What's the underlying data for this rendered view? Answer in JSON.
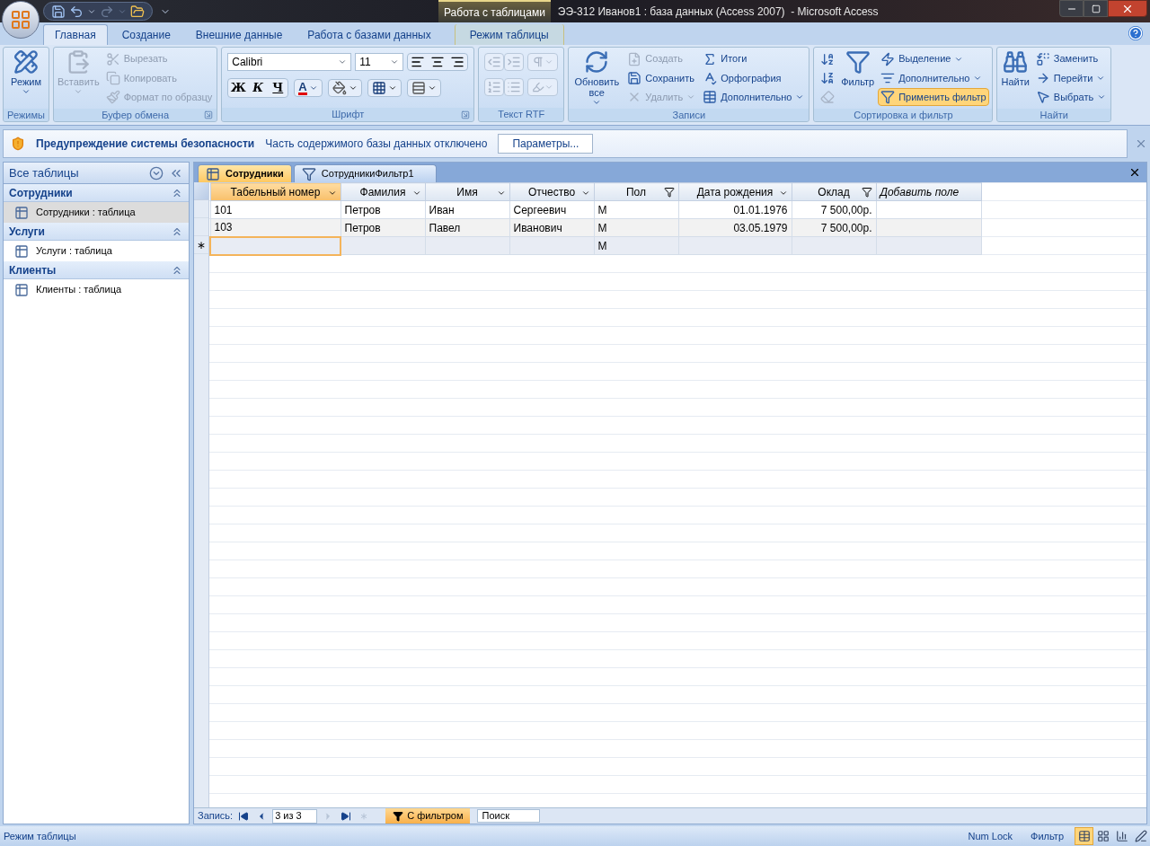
{
  "title_bar": {
    "context_tab": "Работа с таблицами",
    "title": "ЭЭ-312 Иванов1 : база данных (Access 2007)  - Microsoft Access"
  },
  "ribbon_tabs": [
    {
      "label": "Главная",
      "selected": true,
      "kind": "normal"
    },
    {
      "label": "Создание",
      "selected": false,
      "kind": "normal"
    },
    {
      "label": "Внешние данные",
      "selected": false,
      "kind": "normal"
    },
    {
      "label": "Работа с базами данных",
      "selected": false,
      "kind": "normal"
    },
    {
      "label": "Режим таблицы",
      "selected": false,
      "kind": "context"
    }
  ],
  "ribbon_groups": [
    {
      "label": "Режимы",
      "kind": "buttons",
      "sections": [
        {
          "kind": "large",
          "items": [
            {
              "label": "Режим",
              "disabled": false,
              "dropdown": true
            }
          ]
        }
      ]
    },
    {
      "label": "Буфер обмена",
      "kind": "buttons",
      "launcher": true,
      "sections": [
        {
          "kind": "large",
          "items": [
            {
              "label": "Вставить",
              "disabled": true,
              "dropdown": true
            }
          ]
        },
        {
          "kind": "column",
          "items": [
            {
              "label": "Вырезать",
              "disabled": true
            },
            {
              "label": "Копировать",
              "disabled": true
            },
            {
              "label": "Формат по образцу",
              "disabled": true
            }
          ]
        }
      ]
    },
    {
      "label": "Шрифт",
      "kind": "font",
      "launcher": true,
      "font": "Calibri",
      "size": "11",
      "format_buttons": [
        "Ж",
        "К",
        "Ч"
      ],
      "font_color_glyph": "A"
    },
    {
      "label": "Текст RTF",
      "kind": "rtf"
    },
    {
      "label": "Записи",
      "kind": "buttons",
      "sections": [
        {
          "kind": "large",
          "items": [
            {
              "label": "Обновить все",
              "disabled": false,
              "dropdown": true
            }
          ]
        },
        {
          "kind": "column",
          "items": [
            {
              "label": "Создать",
              "disabled": true
            },
            {
              "label": "Сохранить",
              "disabled": false
            },
            {
              "label": "Удалить",
              "disabled": true,
              "dropdown": true
            }
          ]
        },
        {
          "kind": "column",
          "items": [
            {
              "label": "Итоги",
              "disabled": false
            },
            {
              "label": "Орфография",
              "disabled": false
            },
            {
              "label": "Дополнительно",
              "disabled": false,
              "dropdown": true
            }
          ]
        }
      ]
    },
    {
      "label": "Сортировка и фильтр",
      "kind": "buttons",
      "sections": [
        {
          "kind": "column",
          "items": [
            {
              "disabled": false
            },
            {
              "disabled": false
            },
            {
              "disabled": true
            }
          ]
        },
        {
          "kind": "large",
          "items": [
            {
              "label": "Фильтр",
              "disabled": false
            }
          ]
        },
        {
          "kind": "column",
          "items": [
            {
              "label": "Выделение",
              "disabled": false,
              "dropdown": true
            },
            {
              "label": "Дополнительно",
              "disabled": false,
              "dropdown": true
            },
            {
              "label": "Применить фильтр",
              "disabled": false,
              "active": true
            }
          ]
        }
      ]
    },
    {
      "label": "Найти",
      "kind": "buttons",
      "sections": [
        {
          "kind": "large",
          "items": [
            {
              "label": "Найти",
              "disabled": false
            }
          ]
        },
        {
          "kind": "column",
          "items": [
            {
              "label": "Заменить",
              "disabled": false
            },
            {
              "label": "Перейти",
              "disabled": false,
              "dropdown": true
            },
            {
              "label": "Выбрать",
              "disabled": false,
              "dropdown": true
            }
          ]
        }
      ]
    }
  ],
  "security_bar": {
    "title": "Предупреждение системы безопасности",
    "message": "Часть содержимого базы данных отключено",
    "button": "Параметры..."
  },
  "nav_pane": {
    "header": "Все таблицы",
    "groups": [
      {
        "label": "Сотрудники",
        "items": [
          {
            "label": "Сотрудники : таблица",
            "selected": true
          }
        ]
      },
      {
        "label": "Услуги",
        "items": [
          {
            "label": "Услуги : таблица",
            "selected": false
          }
        ]
      },
      {
        "label": "Клиенты",
        "items": [
          {
            "label": "Клиенты : таблица",
            "selected": false
          }
        ]
      }
    ]
  },
  "doc_tabs": [
    {
      "label": "Сотрудники",
      "selected": true,
      "kind": "table"
    },
    {
      "label": "СотрудникиФильтр1",
      "selected": false,
      "kind": "filter"
    }
  ],
  "table": {
    "columns": [
      {
        "label": "Табельный номер",
        "kind": "field",
        "filtered": false,
        "numeric": false,
        "selected": true
      },
      {
        "label": "Фамилия",
        "kind": "field",
        "filtered": false,
        "numeric": false,
        "selected": false
      },
      {
        "label": "Имя",
        "kind": "field",
        "filtered": false,
        "numeric": false,
        "selected": false
      },
      {
        "label": "Отчество",
        "kind": "field",
        "filtered": false,
        "numeric": false,
        "selected": false
      },
      {
        "label": "Пол",
        "kind": "field",
        "filtered": true,
        "numeric": false,
        "selected": false
      },
      {
        "label": "Дата рождения",
        "kind": "field",
        "filtered": false,
        "numeric": true,
        "selected": false
      },
      {
        "label": "Оклад",
        "kind": "field",
        "filtered": true,
        "numeric": true,
        "selected": false
      },
      {
        "label": "Добавить поле",
        "kind": "add",
        "selected": false
      }
    ],
    "rows": [
      {
        "kind": "record",
        "cells": [
          "101",
          "Петров",
          "Иван",
          "Сергеевич",
          "М",
          "01.01.1976",
          "7 500,00р.",
          null
        ]
      },
      {
        "kind": "record",
        "cells": [
          "103",
          "Петров",
          "Павел",
          "Иванович",
          "М",
          "03.05.1979",
          "7 500,00р.",
          null
        ]
      },
      {
        "kind": "new",
        "marker": "∗",
        "cells": [
          null,
          null,
          null,
          null,
          "М",
          null,
          null,
          null
        ]
      }
    ]
  },
  "record_nav": {
    "label": "Запись:",
    "position": "3 из 3",
    "buttons": [
      {
        "kind": "first",
        "disabled": false
      },
      {
        "kind": "prev",
        "disabled": false
      },
      {
        "kind": "next",
        "disabled": true
      },
      {
        "kind": "last",
        "disabled": false
      },
      {
        "kind": "new",
        "disabled": true
      }
    ],
    "filter_button": "С фильтром",
    "filter_active": true,
    "search_placeholder": "Поиск"
  },
  "status_bar": {
    "text": "Режим таблицы",
    "indicators": [
      "Num Lock",
      "Фильтр"
    ],
    "views": [
      {
        "selected": true
      },
      {
        "selected": false
      },
      {
        "selected": false
      },
      {
        "selected": false
      }
    ]
  }
}
